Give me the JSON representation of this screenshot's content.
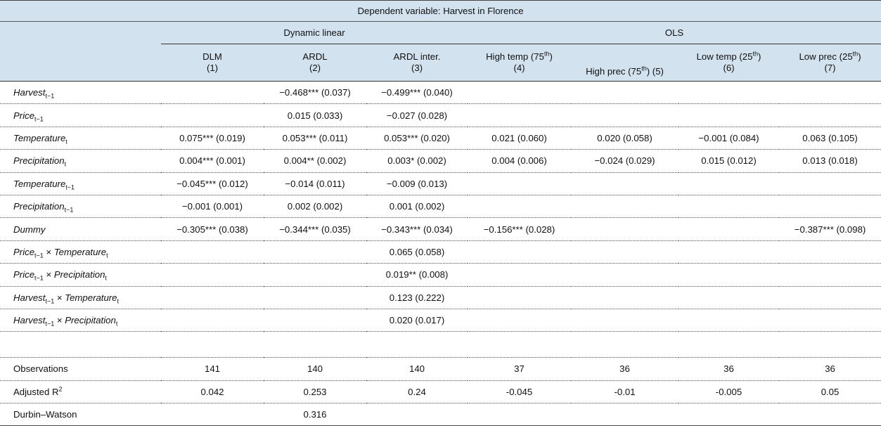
{
  "header": {
    "dependent_variable": "Dependent variable: Harvest in Florence",
    "group_dynamic": "Dynamic linear",
    "group_ols": "OLS"
  },
  "columns": [
    {
      "name": "DLM",
      "num": "(1)"
    },
    {
      "name": "ARDL",
      "num": "(2)"
    },
    {
      "name": "ARDL inter.",
      "num": "(3)"
    },
    {
      "name": "High temp (75",
      "sup": "th",
      "post": ")",
      "num": "(4)"
    },
    {
      "name": "High prec (75",
      "sup": "th",
      "post": ") (5)"
    },
    {
      "name": "Low temp (25",
      "sup": "th",
      "post": ")",
      "num": "(6)"
    },
    {
      "name": "Low prec (25",
      "sup": "th",
      "post": ")",
      "num": "(7)"
    }
  ],
  "rows": [
    {
      "label": "Harvest",
      "sub": "t−1",
      "vals": [
        "",
        "−0.468*** (0.037)",
        "−0.499*** (0.040)",
        "",
        "",
        "",
        ""
      ]
    },
    {
      "label": "Price",
      "sub": "t−1",
      "vals": [
        "",
        "0.015 (0.033)",
        "−0.027 (0.028)",
        "",
        "",
        "",
        ""
      ]
    },
    {
      "label": "Temperature",
      "sub": "t",
      "vals": [
        "0.075*** (0.019)",
        "0.053*** (0.011)",
        "0.053*** (0.020)",
        "0.021 (0.060)",
        "0.020 (0.058)",
        "−0.001 (0.084)",
        "0.063 (0.105)"
      ]
    },
    {
      "label": "Precipitation",
      "sub": "t",
      "vals": [
        "0.004*** (0.001)",
        "0.004** (0.002)",
        "0.003* (0.002)",
        "0.004 (0.006)",
        "−0.024 (0.029)",
        "0.015 (0.012)",
        "0.013 (0.018)"
      ]
    },
    {
      "label": "Temperature",
      "sub": "t−1",
      "vals": [
        "−0.045*** (0.012)",
        "−0.014 (0.011)",
        "−0.009 (0.013)",
        "",
        "",
        "",
        ""
      ]
    },
    {
      "label": "Precipitation",
      "sub": "t−1",
      "vals": [
        "−0.001 (0.001)",
        "0.002 (0.002)",
        "0.001 (0.002)",
        "",
        "",
        "",
        ""
      ]
    },
    {
      "label": "Dummy",
      "sub": "",
      "vals": [
        "−0.305*** (0.038)",
        "−0.344*** (0.035)",
        "−0.343*** (0.034)",
        "−0.156*** (0.028)",
        "",
        "",
        "−0.387*** (0.098)"
      ]
    },
    {
      "label": "Price",
      "sub": "t−1",
      "times": "Temperature",
      "sub2": "t",
      "vals": [
        "",
        "",
        "0.065 (0.058)",
        "",
        "",
        "",
        ""
      ]
    },
    {
      "label": "Price",
      "sub": "t−1",
      "times": "Precipitation",
      "sub2": "t",
      "vals": [
        "",
        "",
        "0.019** (0.008)",
        "",
        "",
        "",
        ""
      ]
    },
    {
      "label": "Harvest",
      "sub": "t−1",
      "times": "Temperature",
      "sub2": "t",
      "vals": [
        "",
        "",
        "0.123 (0.222)",
        "",
        "",
        "",
        ""
      ]
    },
    {
      "label": "Harvest",
      "sub": "t−1",
      "times": "Precipitation",
      "sub2": "t",
      "vals": [
        "",
        "",
        "0.020 (0.017)",
        "",
        "",
        "",
        ""
      ]
    }
  ],
  "stats": [
    {
      "label": "Observations",
      "vals": [
        "141",
        "140",
        "140",
        "37",
        "36",
        "36",
        "36"
      ]
    },
    {
      "label": "Adjusted R",
      "sup": "2",
      "vals": [
        "0.042",
        "0.253",
        "0.24",
        "-0.045",
        "-0.01",
        "-0.005",
        "0.05"
      ]
    },
    {
      "label": "Durbin–Watson",
      "vals": [
        "",
        "0.316",
        "",
        "",
        "",
        "",
        ""
      ]
    }
  ]
}
